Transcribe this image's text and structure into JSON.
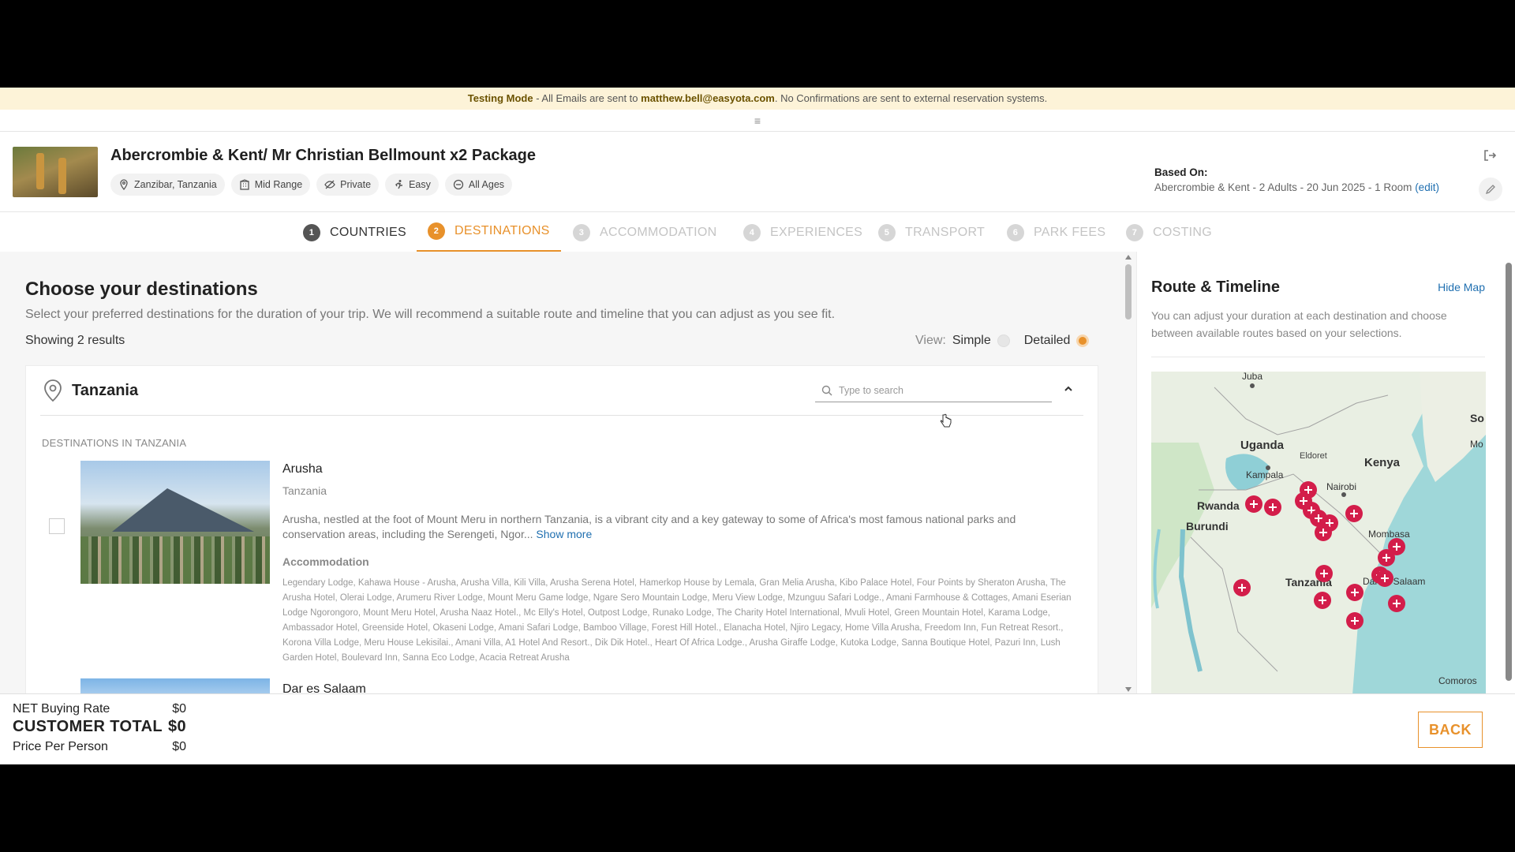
{
  "banner": {
    "mode": "Testing Mode",
    "text1": " - All Emails are sent to ",
    "email": "matthew.bell@easyota.com",
    "text2": ". No Confirmations are sent to external reservation systems."
  },
  "menu_icon": "≡",
  "package": {
    "title": "Abercrombie & Kent/ Mr Christian Bellmount x2 Package",
    "tags": [
      {
        "label": "Zanzibar, Tanzania",
        "icon": "map-pin"
      },
      {
        "label": "Mid Range",
        "icon": "building"
      },
      {
        "label": "Private",
        "icon": "eye-slash"
      },
      {
        "label": "Easy",
        "icon": "running"
      },
      {
        "label": "All Ages",
        "icon": "circle-minus"
      }
    ],
    "based_on_label": "Based On:",
    "based_on_value": "Abercrombie & Kent - 2 Adults - 20 Jun 2025 - 1 Room",
    "edit_link": "(edit)"
  },
  "steps": [
    {
      "num": "1",
      "label": "COUNTRIES",
      "state": "done"
    },
    {
      "num": "2",
      "label": "DESTINATIONS",
      "state": "active"
    },
    {
      "num": "3",
      "label": "ACCOMMODATION",
      "state": "todo"
    },
    {
      "num": "4",
      "label": "EXPERIENCES",
      "state": "todo"
    },
    {
      "num": "5",
      "label": "TRANSPORT",
      "state": "todo"
    },
    {
      "num": "6",
      "label": "PARK FEES",
      "state": "todo"
    },
    {
      "num": "7",
      "label": "COSTING",
      "state": "todo"
    }
  ],
  "main": {
    "heading": "Choose your destinations",
    "subheading": "Select your preferred destinations for the duration of your trip. We will recommend a suitable route and timeline that you can adjust as you see fit.",
    "showing": "Showing 2 results",
    "view_label": "View:",
    "view_simple": "Simple",
    "view_detailed": "Detailed",
    "view_selected": "Detailed",
    "country": "Tanzania",
    "search_placeholder": "Type to search",
    "section_label": "DESTINATIONS IN TANZANIA",
    "destinations": [
      {
        "name": "Arusha",
        "country": "Tanzania",
        "description": "Arusha, nestled at the foot of Mount Meru in northern Tanzania, is a vibrant city and a key gateway to some of Africa's most famous national parks and conservation areas, including the Serengeti, Ngor...",
        "show_more": "Show more",
        "accommodation_label": "Accommodation",
        "accommodation": "Legendary Lodge, Kahawa House - Arusha, Arusha Villa, Kili Villa, Arusha Serena Hotel, Hamerkop House by Lemala, Gran Melia Arusha, Kibo Palace Hotel, Four Points by Sheraton Arusha, The Arusha Hotel, Olerai Lodge, Arumeru River Lodge, Mount Meru Game lodge, Ngare Sero Mountain Lodge, Meru View Lodge, Mzunguu Safari Lodge., Amani Farmhouse & Cottages, Amani Eserian Lodge Ngorongoro, Mount Meru Hotel, Arusha Naaz Hotel., Mc Elly's Hotel, Outpost Lodge, Runako Lodge, The Charity Hotel International, Mvuli Hotel, Green Mountain Hotel, Karama Lodge, Ambassador Hotel, Greenside Hotel, Okaseni Lodge, Amani Safari Lodge, Bamboo Village, Forest Hill Hotel., Elanacha Hotel, Njiro Legacy, Home Villa Arusha, Freedom Inn, Fun Retreat Resort., Korona Villa Lodge, Meru House Lekisilai., Amani Villa, A1 Hotel And Resort., Dik Dik Hotel., Heart Of Africa Lodge., Arusha Giraffe Lodge, Kutoka Lodge, Sanna Boutique Hotel, Pazuri Inn, Lush Garden Hotel, Boulevard Inn, Sanna Eco Lodge, Acacia Retreat Arusha"
      },
      {
        "name": "Dar es Salaam"
      }
    ]
  },
  "side": {
    "title": "Route & Timeline",
    "hide_map": "Hide Map",
    "description": "You can adjust your duration at each destination and choose between available routes based on your selections.",
    "map_labels": {
      "juba": "Juba",
      "uganda": "Uganda",
      "kenya": "Kenya",
      "kampala": "Kampala",
      "eldoret": "Eldoret",
      "nairobi": "Nairobi",
      "rwanda": "Rwanda",
      "burundi": "Burundi",
      "mombasa": "Mombasa",
      "tanzania": "Tanzania",
      "dar": "Dar es Salaam",
      "comoros": "Comoros",
      "so": "So",
      "mo": "Mo"
    }
  },
  "footer": {
    "net_label": "NET Buying Rate",
    "net_value": "$0",
    "total_label": "CUSTOMER TOTAL",
    "total_value": "$0",
    "ppp_label": "Price Per Person",
    "ppp_value": "$0",
    "back": "BACK"
  },
  "colors": {
    "accent": "#e8912b",
    "link": "#1f6fb0",
    "banner_bg": "#fdf3d8",
    "marker": "#d31d4a"
  }
}
